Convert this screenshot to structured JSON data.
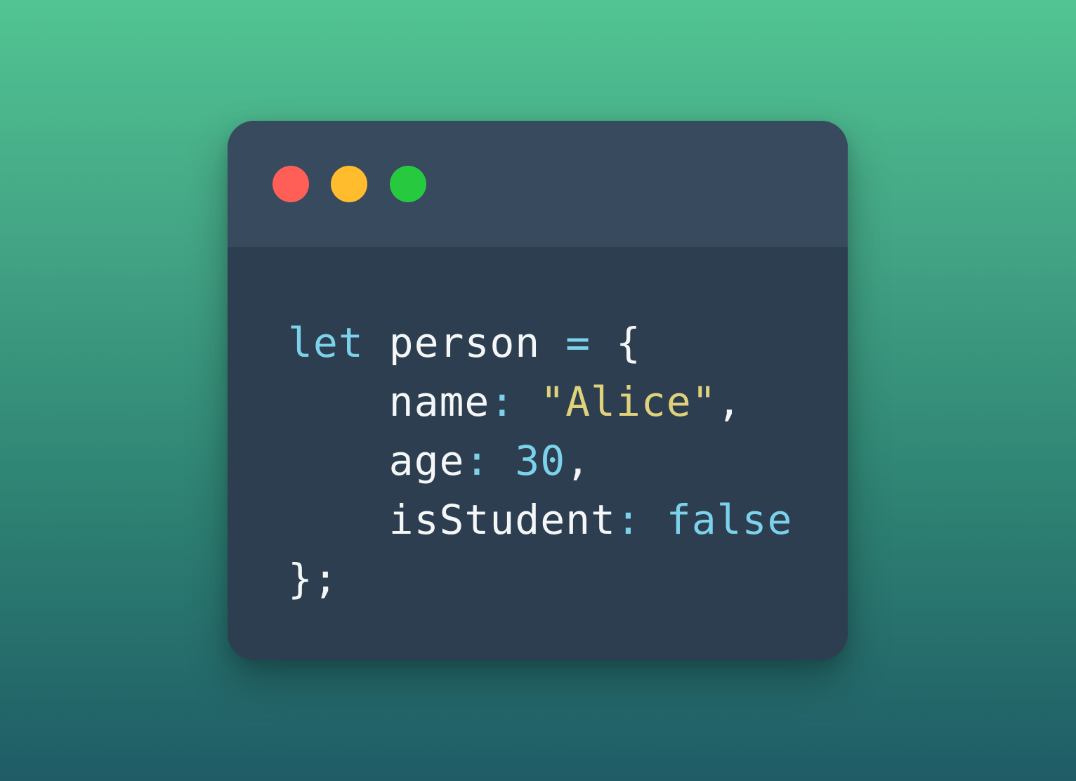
{
  "colors": {
    "background_top": "#52c492",
    "background_bottom": "#1f5c66",
    "window_body": "#2c3e50",
    "title_bar": "#384a5d",
    "close_dot": "#ff5f56",
    "minimize_dot": "#ffbd2e",
    "maximize_dot": "#27c93f",
    "keyword": "#7cd2ea",
    "operator": "#7cd2ea",
    "string": "#e0d27a",
    "number": "#7cd2ea",
    "boolean": "#7cd2ea",
    "plain": "#f4f6f8"
  },
  "window_controls": [
    {
      "name": "close-dot",
      "color_key": "close_dot"
    },
    {
      "name": "minimize-dot",
      "color_key": "minimize_dot"
    },
    {
      "name": "maximize-dot",
      "color_key": "maximize_dot"
    }
  ],
  "code": {
    "language": "javascript",
    "lines": [
      [
        {
          "text": "let",
          "type": "keyword"
        },
        {
          "text": " person ",
          "type": "plain"
        },
        {
          "text": "=",
          "type": "operator"
        },
        {
          "text": " {",
          "type": "plain"
        }
      ],
      [
        {
          "text": "    name",
          "type": "plain"
        },
        {
          "text": ":",
          "type": "operator"
        },
        {
          "text": " ",
          "type": "plain"
        },
        {
          "text": "\"Alice\"",
          "type": "string"
        },
        {
          "text": ",",
          "type": "plain"
        }
      ],
      [
        {
          "text": "    age",
          "type": "plain"
        },
        {
          "text": ":",
          "type": "operator"
        },
        {
          "text": " ",
          "type": "plain"
        },
        {
          "text": "30",
          "type": "number"
        },
        {
          "text": ",",
          "type": "plain"
        }
      ],
      [
        {
          "text": "    isStudent",
          "type": "plain"
        },
        {
          "text": ":",
          "type": "operator"
        },
        {
          "text": " ",
          "type": "plain"
        },
        {
          "text": "false",
          "type": "boolean"
        }
      ],
      [
        {
          "text": "};",
          "type": "plain"
        }
      ]
    ]
  }
}
